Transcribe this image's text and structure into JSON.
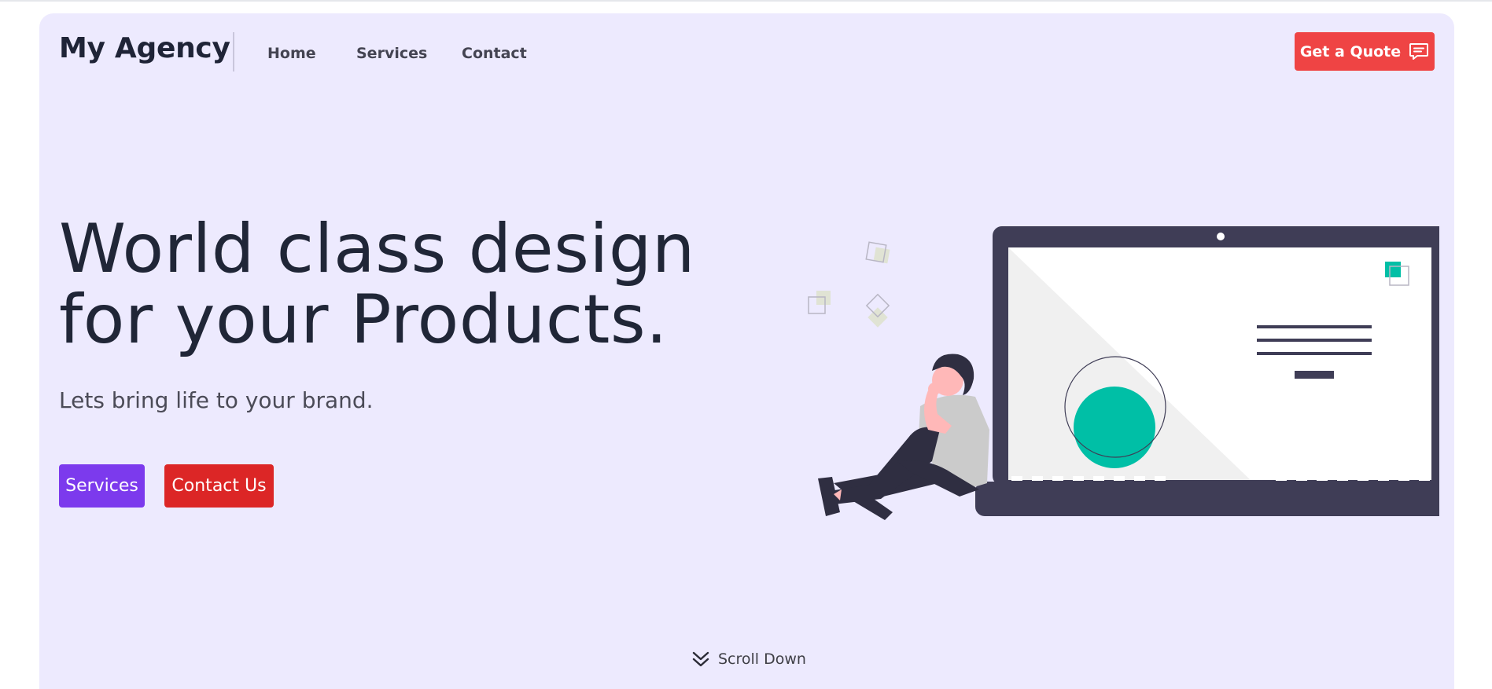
{
  "header": {
    "brand": "My Agency",
    "nav": [
      {
        "label": "Home"
      },
      {
        "label": "Services"
      },
      {
        "label": "Contact"
      }
    ],
    "cta_label": "Get a Quote",
    "cta_icon": "chat-bubble-icon"
  },
  "hero": {
    "headline_line1": "World class design",
    "headline_line2": "for your Products.",
    "subheadline": "Lets bring life to your brand.",
    "primary_button": "Services",
    "secondary_button": "Contact Us",
    "scroll_label": "Scroll Down",
    "scroll_icon": "double-chevron-down-icon"
  },
  "colors": {
    "hero_background": "#edeafe",
    "brand_text": "#1f2437",
    "quote_button": "#ef4444",
    "services_button": "#7c3aed",
    "contact_button": "#dc2626",
    "laptop": "#3f3d56",
    "accent_teal": "#00bfa6"
  }
}
